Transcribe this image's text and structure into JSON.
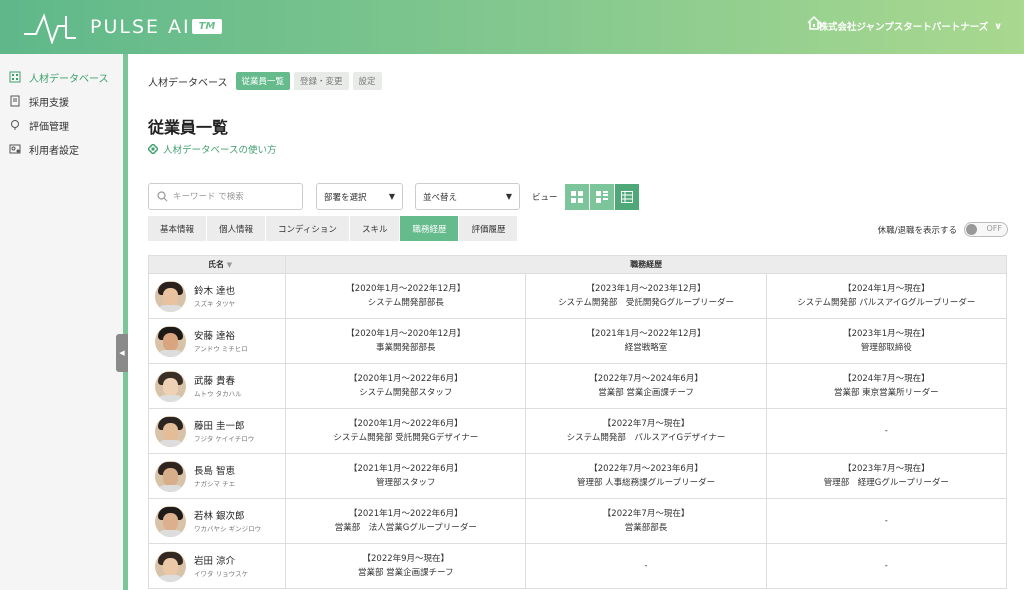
{
  "header": {
    "logo_text": "PULSE AI",
    "logo_tm": "TM",
    "company": "株式会社ジャンプスタートパートナーズ",
    "company_chevron": "∨"
  },
  "sidebar": {
    "items": [
      {
        "label": "人材データベース",
        "icon": "database-icon",
        "active": true
      },
      {
        "label": "採用支援",
        "icon": "document-icon",
        "active": false
      },
      {
        "label": "評価管理",
        "icon": "award-icon",
        "active": false
      },
      {
        "label": "利用者設定",
        "icon": "user-settings-icon",
        "active": false
      }
    ],
    "collapse_glyph": "◀"
  },
  "breadcrumb": {
    "root": "人材データベース",
    "tabs": [
      {
        "label": "従業員一覧",
        "active": true
      },
      {
        "label": "登録・変更",
        "active": false
      },
      {
        "label": "設定",
        "active": false
      }
    ]
  },
  "page": {
    "title": "従業員一覧",
    "help_link": "人材データベースの使い方"
  },
  "filters": {
    "search_placeholder": "キーワード で検索",
    "department": "部署を選択",
    "sort": "並べ替え",
    "view_label": "ビュー",
    "arrow": "▼"
  },
  "tabs": [
    {
      "label": "基本情報",
      "active": false
    },
    {
      "label": "個人情報",
      "active": false
    },
    {
      "label": "コンディション",
      "active": false
    },
    {
      "label": "スキル",
      "active": false
    },
    {
      "label": "職務経歴",
      "active": true
    },
    {
      "label": "評価履歴",
      "active": false
    }
  ],
  "toggle": {
    "label": "休職/退職を表示する",
    "state": "OFF"
  },
  "table": {
    "header_name": "氏名",
    "header_sort": "▼",
    "header_career": "職務経歴",
    "rows": [
      {
        "name": "鈴木 達也",
        "kana": "スズキ タツヤ",
        "careers": [
          {
            "period": "【2020年1月〜2022年12月】",
            "role": "システム開発部部長"
          },
          {
            "period": "【2023年1月〜2023年12月】",
            "role": "システム開発部　受託開発Gグループリーダー"
          },
          {
            "period": "【2024年1月〜現在】",
            "role": "システム開発部 パルスアイGグループリーダー"
          }
        ]
      },
      {
        "name": "安藤 達裕",
        "kana": "アンドウ ミチヒロ",
        "careers": [
          {
            "period": "【2020年1月〜2020年12月】",
            "role": "事業開発部部長"
          },
          {
            "period": "【2021年1月〜2022年12月】",
            "role": "経営戦略室"
          },
          {
            "period": "【2023年1月〜現在】",
            "role": "管理部取締役"
          }
        ]
      },
      {
        "name": "武藤 貴春",
        "kana": "ムトウ タカハル",
        "careers": [
          {
            "period": "【2020年1月〜2022年6月】",
            "role": "システム開発部スタッフ"
          },
          {
            "period": "【2022年7月〜2024年6月】",
            "role": "営業部 営業企画課チーフ"
          },
          {
            "period": "【2024年7月〜現在】",
            "role": "営業部 東京営業所リーダー"
          }
        ]
      },
      {
        "name": "藤田 圭一郎",
        "kana": "フジタ ケイイチロウ",
        "careers": [
          {
            "period": "【2020年1月〜2022年6月】",
            "role": "システム開発部 受託開発Gデザイナー"
          },
          {
            "period": "【2022年7月〜現在】",
            "role": "システム開発部　パルスアイGデザイナー"
          },
          {
            "period": "",
            "role": "-"
          }
        ]
      },
      {
        "name": "長島 智恵",
        "kana": "ナガシマ チエ",
        "careers": [
          {
            "period": "【2021年1月〜2022年6月】",
            "role": "管理部スタッフ"
          },
          {
            "period": "【2022年7月〜2023年6月】",
            "role": "管理部 人事総務課グループリーダー"
          },
          {
            "period": "【2023年7月〜現在】",
            "role": "管理部　経理Gグループリーダー"
          }
        ]
      },
      {
        "name": "若林 銀次郎",
        "kana": "ワカバヤシ ギンジロウ",
        "careers": [
          {
            "period": "【2021年1月〜2022年6月】",
            "role": "営業部　法人営業Gグループリーダー"
          },
          {
            "period": "【2022年7月〜現在】",
            "role": "営業部部長"
          },
          {
            "period": "",
            "role": "-"
          }
        ]
      },
      {
        "name": "岩田 涼介",
        "kana": "イワタ リョウスケ",
        "careers": [
          {
            "period": "【2022年9月〜現在】",
            "role": "営業部 営業企画課チーフ"
          },
          {
            "period": "",
            "role": "-"
          },
          {
            "period": "",
            "role": "-"
          }
        ]
      }
    ]
  }
}
